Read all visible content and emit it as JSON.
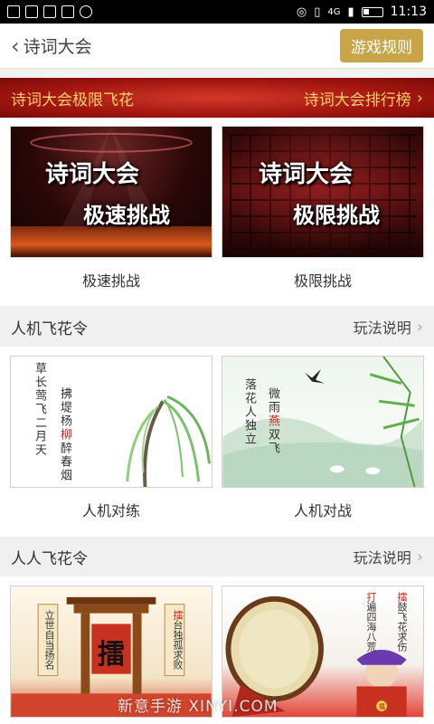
{
  "status_bar": {
    "time": "11:13",
    "network": "4G"
  },
  "header": {
    "back_label": "诗词大会",
    "rules_button": "游戏规则"
  },
  "banner": {
    "left": "诗词大会极限飞花",
    "right": "诗词大会排行榜"
  },
  "challenge_cards": [
    {
      "label": "极速挑战",
      "image_title": "诗词大会",
      "image_subtitle": "极速挑战"
    },
    {
      "label": "极限挑战",
      "image_title": "诗词大会",
      "image_subtitle": "极限挑战"
    }
  ],
  "section_ai": {
    "title": "人机飞花令",
    "link": "玩法说明",
    "cards": [
      {
        "label": "人机对练",
        "poem_col1": "草长莺飞二月天",
        "poem_col2a": "拂堤杨",
        "poem_col2_red": "柳",
        "poem_col2b": "醉春烟"
      },
      {
        "label": "人机对战",
        "poem_col1": "落花人独立",
        "poem_col2a": "微雨",
        "poem_col2_red": "燕",
        "poem_col2b": "双飞"
      }
    ]
  },
  "section_pvp": {
    "title": "人人飞花令",
    "link": "玩法说明",
    "cards": [
      {
        "center_char": "擂",
        "left_scroll": "立世自当扬名",
        "right_scroll_red": "擂",
        "right_scroll": "台独孤求败"
      },
      {
        "right_col_red": "擂",
        "right_col": "鼓飞花求伤",
        "left_col_red": "打",
        "left_col": "遍四海八荒",
        "badge": "擂"
      }
    ]
  },
  "watermark": "新意手游 XINYI.COM"
}
